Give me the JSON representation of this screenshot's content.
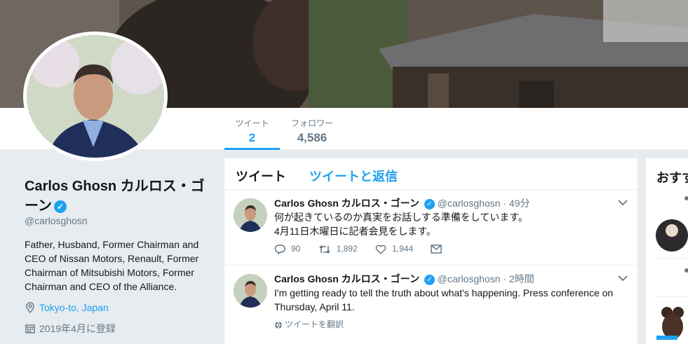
{
  "stats": {
    "tweets_label": "ツイート",
    "tweets_count": "2",
    "followers_label": "フォロワー",
    "followers_count": "4,586"
  },
  "profile": {
    "name": "Carlos Ghosn カルロス・ゴーン",
    "handle": "@carlosghosn",
    "bio": "Father, Husband, Former Chairman and CEO of Nissan Motors, Renault, Former Chairman of Mitsubishi Motors, Former Chairman and CEO of the Alliance.",
    "location": "Tokyo-to, Japan",
    "joined": "2019年4月に登録"
  },
  "timeline": {
    "tab_tweets": "ツイート",
    "tab_replies": "ツイートと返信",
    "tweets": [
      {
        "name": "Carlos Ghosn カルロス・ゴーン",
        "handle": "@carlosghosn",
        "time": "· 49分",
        "text_line1": "何が起きているのか真実をお話しする準備をしています。",
        "text_line2": "4月11日木曜日に記者会見をします。",
        "replies": "90",
        "retweets": "1,892",
        "likes": "1,944"
      },
      {
        "name": "Carlos Ghosn カルロス・ゴーン",
        "handle": "@carlosghosn",
        "time": "· 2時間",
        "text": "I'm getting ready to tell the truth about what's happening.  Press conference on Thursday, April 11.",
        "translate": "ツイートを翻訳"
      }
    ]
  },
  "sidebar": {
    "title": "おすすめ"
  },
  "colors": {
    "accent": "#1da1f2",
    "muted": "#657786",
    "background": "#e6ecf0"
  }
}
